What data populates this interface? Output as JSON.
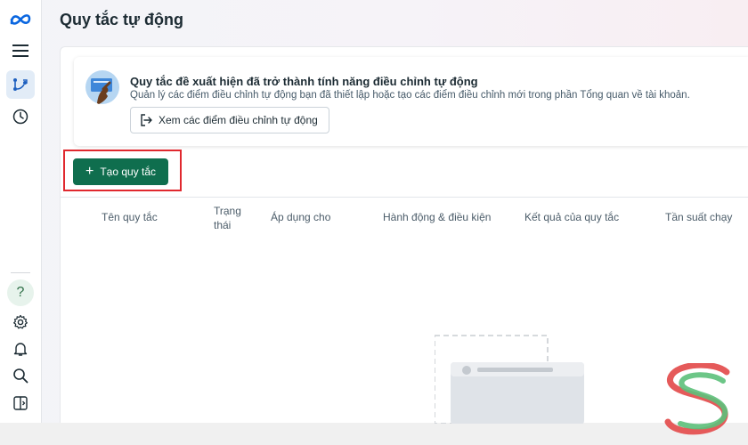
{
  "page": {
    "title": "Quy tắc tự động"
  },
  "banner": {
    "title": "Quy tắc đề xuất hiện đã trở thành tính năng điều chỉnh tự động",
    "description": "Quản lý các điểm điều chỉnh tự động bạn đã thiết lập hoặc tạo các điểm điều chỉnh mới trong phần Tổng quan về tài khoản.",
    "button_label": "Xem các điểm điều chỉnh tự động"
  },
  "toolbar": {
    "create_label": "Tạo quy tắc",
    "create_color": "#0f6e4e",
    "highlight_color": "#e0282e"
  },
  "table": {
    "columns": [
      "Tên quy tắc",
      "Trạng thái",
      "Áp dụng cho",
      "Hành động & điều kiện",
      "Kết quả của quy tắc",
      "Tần suất chạy"
    ]
  },
  "rail": {
    "icons": [
      "meta-logo-icon",
      "menu-icon",
      "automated-rules-icon",
      "history-clock-icon",
      "help-icon",
      "settings-gear-icon",
      "notifications-bell-icon",
      "search-icon",
      "panel-toggle-icon"
    ],
    "help_symbol": "?"
  }
}
